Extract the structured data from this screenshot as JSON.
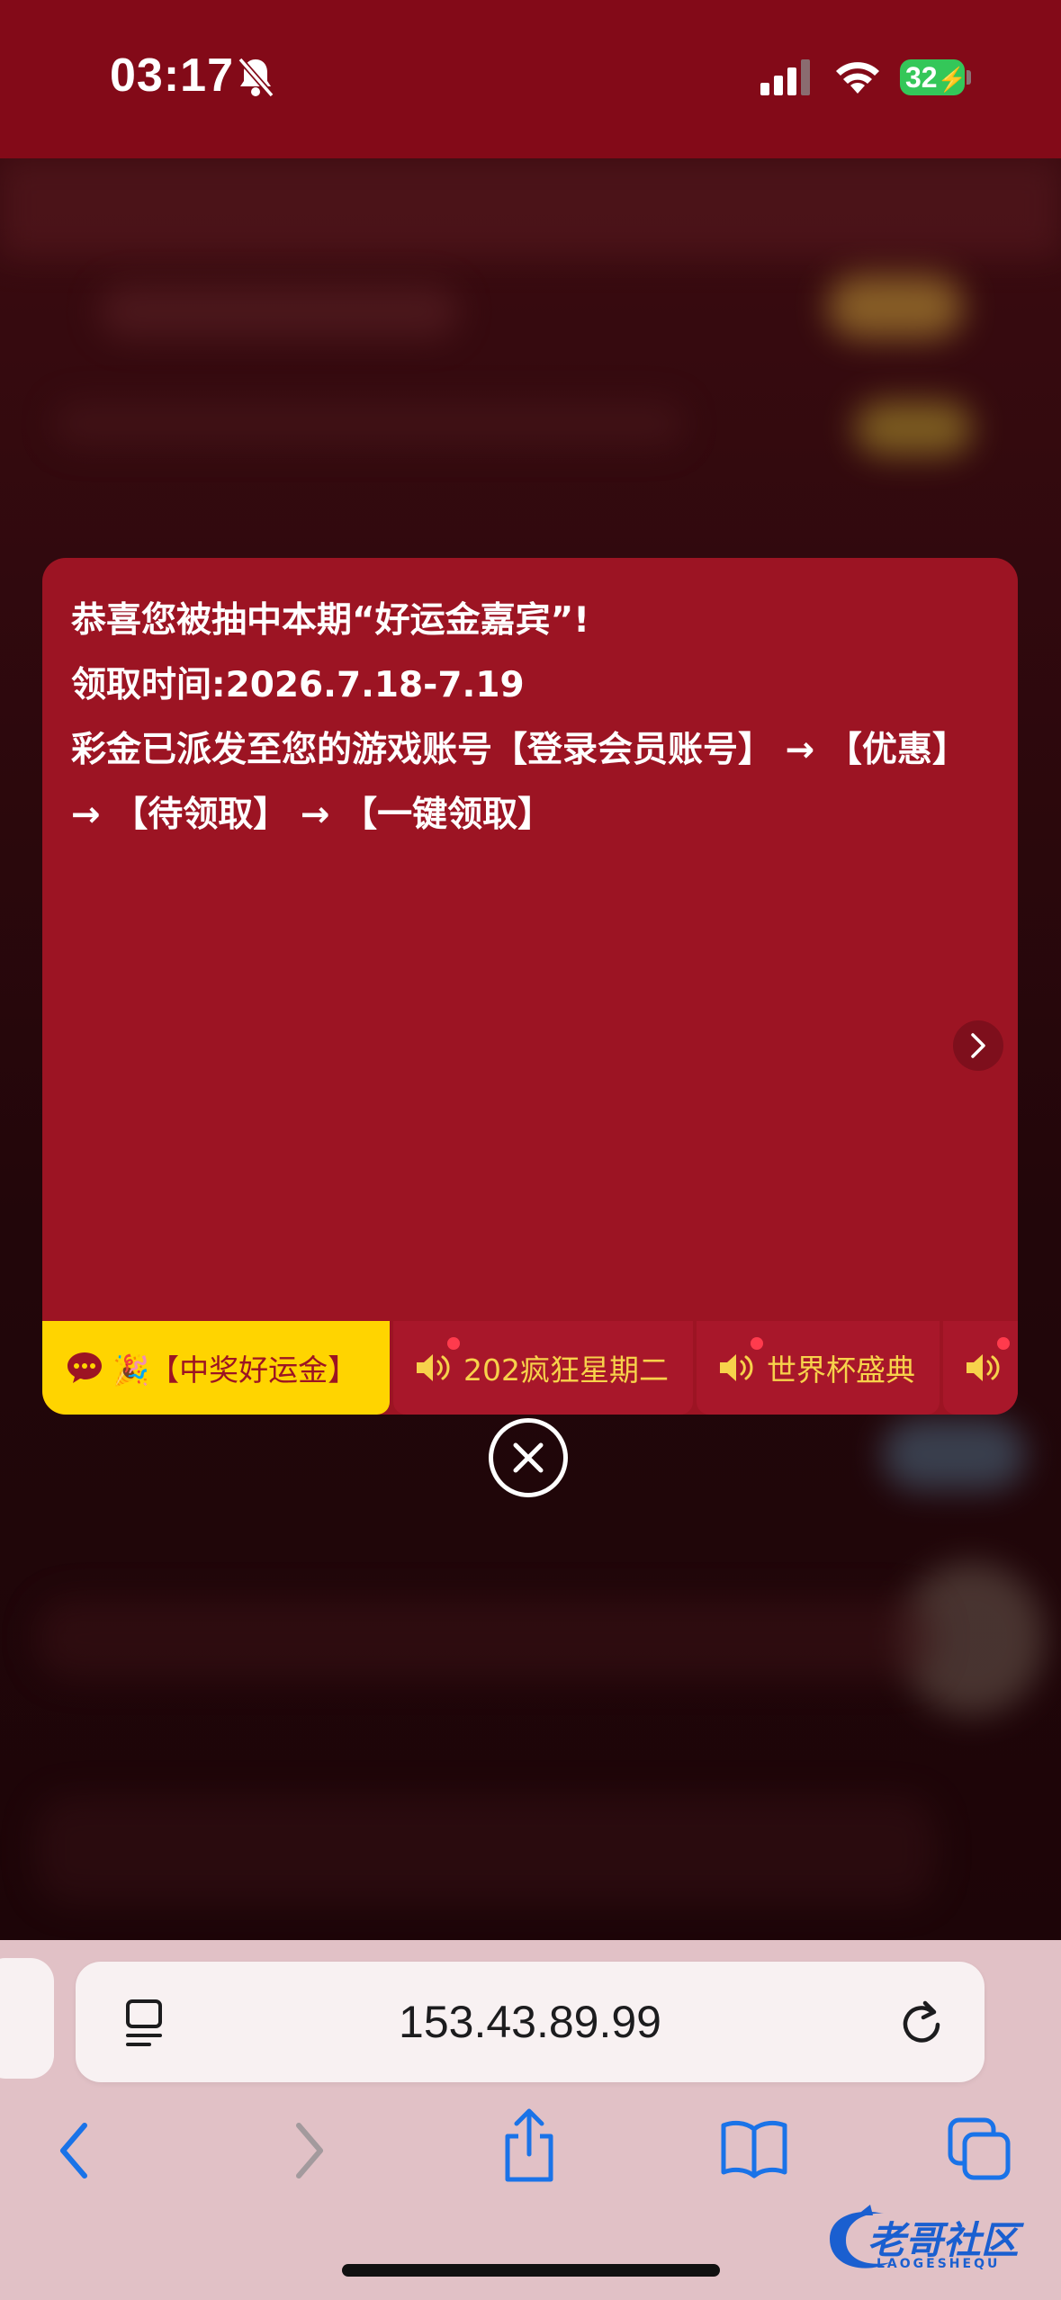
{
  "status_bar": {
    "time": "03:17",
    "battery_level": "32"
  },
  "modal": {
    "message": "恭喜您被抽中本期“好运金嘉宾”!\n领取时间:2026.7.18-7.19\n彩金已派发至您的游戏账号【登录会员账号】 → 【优惠】 → 【待领取】 → 【一键领取】",
    "tabs": [
      {
        "label": "🎉【中奖好运金】",
        "icon": "chat-bubble-icon",
        "active": true
      },
      {
        "label": "202疯狂星期二",
        "icon": "speaker-icon",
        "active": false
      },
      {
        "label": "世界杯盛典",
        "icon": "speaker-icon",
        "active": false
      },
      {
        "label": "",
        "icon": "speaker-icon",
        "active": false
      }
    ]
  },
  "browser": {
    "url": "153.43.89.99"
  },
  "watermark": {
    "text": "老哥社区",
    "subtext": "LAOGESHEQU"
  },
  "colors": {
    "status_bar": "#830a18",
    "modal_bg": "#9c1423",
    "active_tab": "#ffd400",
    "tab_text": "#f7d24b",
    "toolbar_bg": "#e1c1c6",
    "ios_blue": "#1a73e8"
  }
}
